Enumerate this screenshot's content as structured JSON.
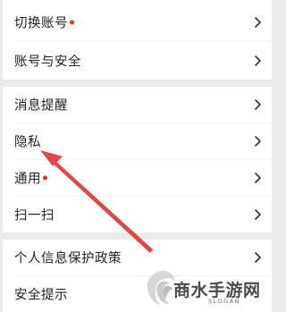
{
  "settings": {
    "group1": {
      "items": [
        {
          "label": "切换账号",
          "has_badge": true
        },
        {
          "label": "账号与安全",
          "has_badge": false
        }
      ]
    },
    "group2": {
      "items": [
        {
          "label": "消息提醒",
          "has_badge": false
        },
        {
          "label": "隐私",
          "has_badge": false
        },
        {
          "label": "通用",
          "has_badge": true
        },
        {
          "label": "扫一扫",
          "has_badge": false
        }
      ]
    },
    "group3": {
      "items": [
        {
          "label": "个人信息保护政策",
          "has_badge": false
        },
        {
          "label": "安全提示",
          "has_badge": false
        }
      ]
    }
  },
  "icons": {
    "chevron": "chevron-right-icon",
    "badge": "red-dot-badge"
  },
  "colors": {
    "badge": "#e5322d",
    "annotation_arrow": "#e04848",
    "page_background": "#ebebeb",
    "row_background": "#ffffff"
  },
  "watermark": {
    "title": "商水手游网",
    "subtitle": "SLOGAN"
  }
}
